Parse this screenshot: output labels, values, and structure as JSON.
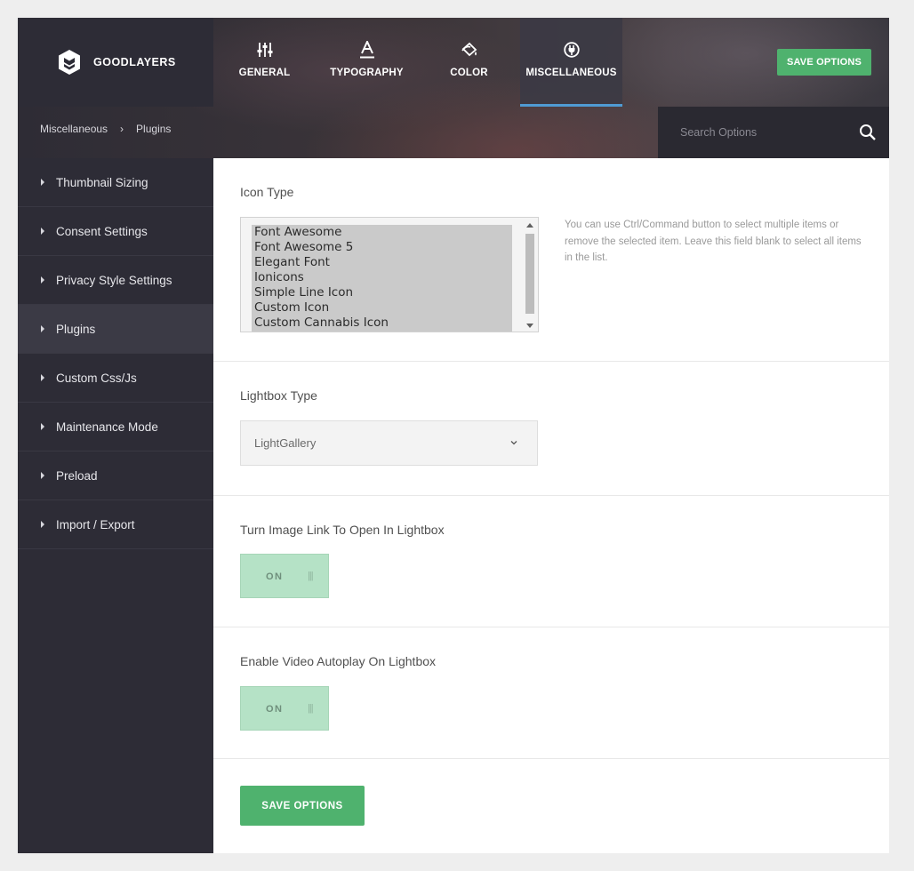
{
  "brand": {
    "name": "GOODLAYERS"
  },
  "tabs": [
    {
      "label": "GENERAL",
      "icon": "sliders-icon"
    },
    {
      "label": "TYPOGRAPHY",
      "icon": "typography-icon"
    },
    {
      "label": "COLOR",
      "icon": "paint-bucket-icon"
    },
    {
      "label": "MISCELLANEOUS",
      "icon": "plug-icon",
      "active": true
    }
  ],
  "header": {
    "save_label": "SAVE OPTIONS"
  },
  "breadcrumb": {
    "parent": "Miscellaneous",
    "separator": "›",
    "current": "Plugins"
  },
  "search": {
    "placeholder": "Search Options",
    "value": ""
  },
  "sidebar": {
    "items": [
      {
        "label": "Thumbnail Sizing"
      },
      {
        "label": "Consent Settings"
      },
      {
        "label": "Privacy Style Settings"
      },
      {
        "label": "Plugins",
        "active": true
      },
      {
        "label": "Custom Css/Js"
      },
      {
        "label": "Maintenance Mode"
      },
      {
        "label": "Preload"
      },
      {
        "label": "Import / Export"
      }
    ]
  },
  "main": {
    "icon_type": {
      "title": "Icon Type",
      "options": [
        "Font Awesome",
        "Font Awesome 5",
        "Elegant Font",
        "Ionicons",
        "Simple Line Icon",
        "Custom Icon",
        "Custom Cannabis Icon"
      ],
      "hint": "You can use Ctrl/Command button to select multiple items or remove the selected item. Leave this field blank to select all items in the list."
    },
    "lightbox_type": {
      "title": "Lightbox Type",
      "value": "LightGallery"
    },
    "image_link": {
      "title": "Turn Image Link To Open In Lightbox",
      "state": "ON",
      "grip": "|||"
    },
    "video_autoplay": {
      "title": "Enable Video Autoplay On Lightbox",
      "state": "ON",
      "grip": "|||"
    },
    "save_label": "SAVE OPTIONS"
  },
  "colors": {
    "accent_green": "#4fb26e",
    "active_tab_underline": "#4f9bd4",
    "sidebar_bg": "#2d2c36",
    "toggle_on_bg": "#b5e2c6"
  }
}
